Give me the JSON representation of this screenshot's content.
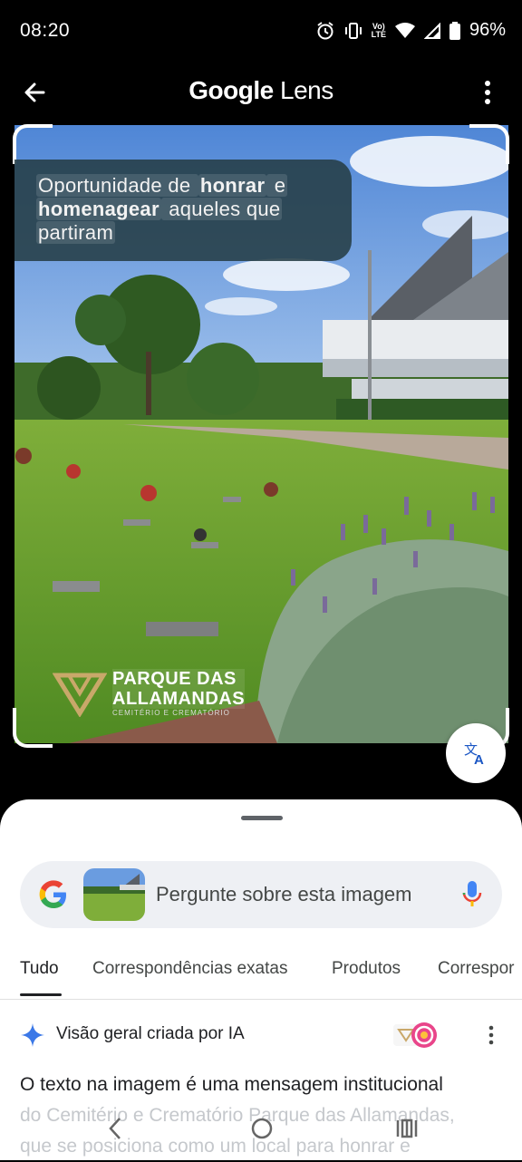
{
  "status_bar": {
    "time": "08:20",
    "lte_top": "Vo)",
    "lte_bottom": "LTE",
    "battery": "96%"
  },
  "app_bar": {
    "title_google": "Google",
    "title_lens": "Lens"
  },
  "image": {
    "overlay_parts": [
      "Oportunidade de ",
      "honrar",
      " e ",
      "homenagear",
      " aqueles que ",
      "partiram"
    ],
    "logo_line1": "PARQUE DAS",
    "logo_line2": "ALLAMANDAS",
    "logo_sub": "CEMITÉRIO E CREMATÓRIO"
  },
  "search": {
    "placeholder": "Pergunte sobre esta imagem"
  },
  "tabs": [
    "Tudo",
    "Correspondências exatas",
    "Produtos",
    "Correspor"
  ],
  "ai_overview": {
    "title": "Visão geral criada por IA",
    "line1": "O texto na imagem é uma mensagem institucional",
    "line2": "do Cemitério e Crematório Parque das Allamandas,",
    "line3": "que se posiciona como um local para honrar e"
  },
  "colors": {
    "sheet_bg": "#ffffff",
    "search_bg": "#eef0f4",
    "accent_blue": "#1a73e8"
  }
}
